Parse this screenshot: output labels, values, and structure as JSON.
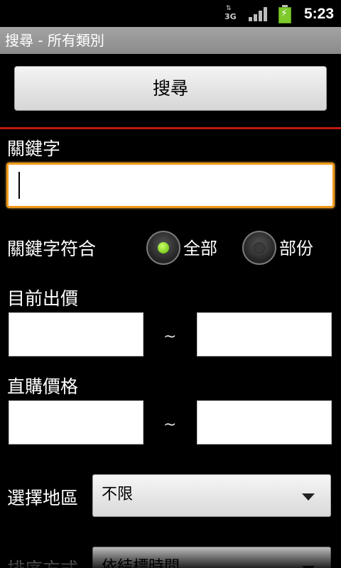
{
  "status_bar": {
    "network_type": "3G",
    "network_arrows": "⇅",
    "time": "5:23"
  },
  "title_bar": {
    "title": "搜尋 - 所有類別"
  },
  "search_button": {
    "label": "搜尋"
  },
  "keyword": {
    "label": "關鍵字",
    "value": ""
  },
  "keyword_match": {
    "label": "關鍵字符合",
    "options": [
      {
        "label": "全部",
        "selected": true
      },
      {
        "label": "部份",
        "selected": false
      }
    ]
  },
  "current_bid": {
    "label": "目前出價",
    "min": "",
    "max": "",
    "separator": "~"
  },
  "buy_now_price": {
    "label": "直購價格",
    "min": "",
    "max": "",
    "separator": "~"
  },
  "region": {
    "label": "選擇地區",
    "value": "不限"
  },
  "sort": {
    "label": "排序方式",
    "value": "依結標時間"
  },
  "colors": {
    "divider": "#c0180f",
    "focus_border": "#f09a1c",
    "radio_on": "#7ed321"
  }
}
